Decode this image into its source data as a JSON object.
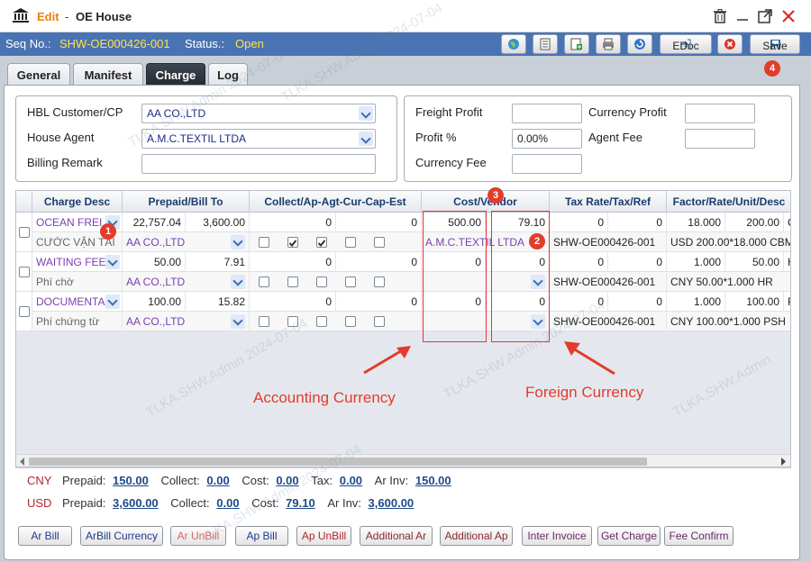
{
  "window": {
    "mode": "Edit",
    "separator": "-",
    "title": "OE House"
  },
  "seqbar": {
    "seq_label": "Seq No.:",
    "seq_value": "SHW-OE000426-001",
    "status_label": "Status.:",
    "status_value": "Open"
  },
  "toolbar": {
    "edoc_label": "EDoc",
    "save_label": "Save"
  },
  "tabs": [
    {
      "label": "General"
    },
    {
      "label": "Manifest"
    },
    {
      "label": "Charge"
    },
    {
      "label": "Log"
    }
  ],
  "form": {
    "hbl_label": "HBL Customer/CP",
    "hbl_value": "AA CO.,LTD",
    "agent_label": "House Agent",
    "agent_value": "A.M.C.TEXTIL LTDA",
    "remark_label": "Billing Remark",
    "remark_value": "",
    "freight_profit_label": "Freight Profit",
    "freight_profit_value": "",
    "profit_pct_label": "Profit %",
    "profit_pct_value": "0.00%",
    "currency_fee_label": "Currency Fee",
    "currency_fee_value": "",
    "currency_profit_label": "Currency Profit",
    "currency_profit_value": "",
    "agent_fee_label": "Agent Fee",
    "agent_fee_value": ""
  },
  "grid": {
    "headers": {
      "charge_desc": "Charge Desc",
      "prepaid": "Prepaid/Bill To",
      "collect": "Collect/Ap-Agt-Cur-Cap-Est",
      "cost": "Cost/Vendor",
      "tax": "Tax Rate/Tax/Ref",
      "factor": "Factor/Rate/Unit/Desc"
    },
    "rows": [
      {
        "desc": "OCEAN FREI",
        "pp1": "22,757.04",
        "pp2": "3,600.00",
        "col1": "0",
        "col2": "0",
        "cost1": "500.00",
        "cost2": "79.10",
        "tax1": "0",
        "tax2": "0",
        "f1": "18.000",
        "f2": "200.00",
        "f3": "C",
        "sub_desc": "CƯỚC VẬN TẢI",
        "bill_to": "AA CO.,LTD",
        "vendor": "A.M.C.TEXTIL LTDA",
        "ref": "SHW-OE000426-001",
        "fdesc": "USD 200.00*18.000 CBM",
        "checks": [
          false,
          true,
          true,
          false,
          false
        ]
      },
      {
        "desc": "WAITING FEE",
        "pp1": "50.00",
        "pp2": "7.91",
        "col1": "0",
        "col2": "0",
        "cost1": "0",
        "cost2": "0",
        "tax1": "0",
        "tax2": "0",
        "f1": "1.000",
        "f2": "50.00",
        "f3": "H",
        "sub_desc": "Phí chờ",
        "bill_to": "AA CO.,LTD",
        "vendor": "",
        "ref": "SHW-OE000426-001",
        "fdesc": "CNY 50.00*1.000 HR",
        "checks": [
          false,
          false,
          false,
          false,
          false
        ]
      },
      {
        "desc": "DOCUMENTA",
        "pp1": "100.00",
        "pp2": "15.82",
        "col1": "0",
        "col2": "0",
        "cost1": "0",
        "cost2": "0",
        "tax1": "0",
        "tax2": "0",
        "f1": "1.000",
        "f2": "100.00",
        "f3": "F",
        "sub_desc": "Phí chứng từ",
        "bill_to": "AA CO.,LTD",
        "vendor": "",
        "ref": "SHW-OE000426-001",
        "fdesc": "CNY 100.00*1.000 PSH",
        "checks": [
          false,
          false,
          false,
          false,
          false
        ]
      }
    ]
  },
  "annotations": {
    "badge1": "1",
    "badge2": "2",
    "badge3": "3",
    "badge4": "4",
    "accounting": "Accounting Currency",
    "foreign": "Foreign Currency"
  },
  "summary": [
    {
      "cur": "CNY",
      "prepaid_label": "Prepaid:",
      "prepaid": "150.00",
      "collect_label": "Collect:",
      "collect": "0.00",
      "cost_label": "Cost:",
      "cost": "0.00",
      "tax_label": "Tax:",
      "tax": "0.00",
      "arinv_label": "Ar Inv:",
      "arinv": "150.00"
    },
    {
      "cur": "USD",
      "prepaid_label": "Prepaid:",
      "prepaid": "3,600.00",
      "collect_label": "Collect:",
      "collect": "0.00",
      "cost_label": "Cost:",
      "cost": "79.10",
      "arinv_label": "Ar Inv:",
      "arinv": "3,600.00"
    }
  ],
  "buttons": {
    "ar_bill": "Ar Bill",
    "arbill_currency": "ArBill Currency",
    "ar_unbill": "Ar UnBill",
    "ap_bill": "Ap Bill",
    "ap_unbill": "Ap UnBill",
    "additional_ar": "Additional Ar",
    "additional_ap": "Additional Ap",
    "inter_invoice": "Inter Invoice",
    "get_charge": "Get Charge",
    "fee_confirm": "Fee Confirm"
  },
  "watermark": {
    "user": "TLKA.SHW.Admin",
    "date": "2024-07-04"
  },
  "colors": {
    "accent": "#4a73b3",
    "annotation": "#e23c2c",
    "edit": "#e8820c"
  }
}
